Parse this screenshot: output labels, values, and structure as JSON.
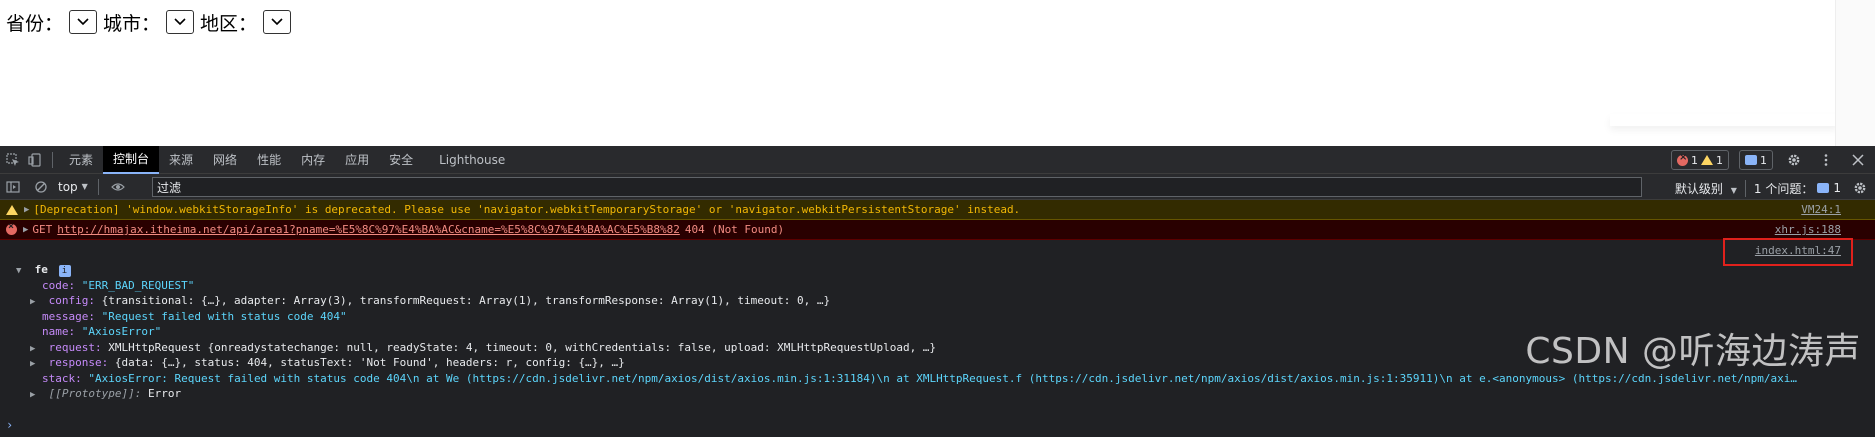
{
  "page_form": {
    "province_label": "省份：",
    "city_label": "城市：",
    "area_label": "地区："
  },
  "devtools": {
    "tabs": [
      "元素",
      "控制台",
      "来源",
      "网络",
      "性能",
      "内存",
      "应用",
      "安全",
      "Lighthouse"
    ],
    "active_tab": "控制台",
    "error_count": "1",
    "warning_count": "1",
    "message_count": "1",
    "context": "top",
    "filter_placeholder": "过滤",
    "level": "默认级别",
    "issues_label": "1 个问题：",
    "issues_count": "1"
  },
  "console": {
    "warning_text": "[Deprecation] 'window.webkitStorageInfo' is deprecated. Please use 'navigator.webkitTemporaryStorage' or 'navigator.webkitPersistentStorage' instead.",
    "warning_source": "VM24:1",
    "error_method": "GET",
    "error_url": "http://hmajax.itheima.net/api/area1?pname=%E5%8C%97%E4%BA%AC&cname=%E5%8C%97%E4%BA%AC%E5%B8%82",
    "error_status": "404 (Not Found)",
    "error_source": "xhr.js:188",
    "object_source": "index.html:47",
    "object_name": "fe",
    "object_info_badge": "i",
    "lines": {
      "code_key": "code:",
      "code_val": "\"ERR_BAD_REQUEST\"",
      "config_key": "config:",
      "config_val": "{transitional: {…}, adapter: Array(3), transformRequest: Array(1), transformResponse: Array(1), timeout: 0, …}",
      "message_key": "message:",
      "message_val": "\"Request failed with status code 404\"",
      "name_key": "name:",
      "name_val": "\"AxiosError\"",
      "request_key": "request:",
      "request_val": "XMLHttpRequest {onreadystatechange: null, readyState: 4, timeout: 0, withCredentials: false, upload: XMLHttpRequestUpload, …}",
      "response_key": "response:",
      "response_val": "{data: {…}, status: 404, statusText: 'Not Found', headers: r, config: {…}, …}",
      "stack_key": "stack:",
      "stack_val": "\"AxiosError: Request failed with status code 404\\n    at We (https://cdn.jsdelivr.net/npm/axios/dist/axios.min.js:1:31184)\\n    at XMLHttpRequest.f (https://cdn.jsdelivr.net/npm/axios/dist/axios.min.js:1:35911)\\n    at e.<anonymous> (https://cdn.jsdelivr.net/npm/axi…",
      "prototype_key": "[[Prototype]]:",
      "prototype_val": "Error"
    },
    "prompt_symbol": "›"
  },
  "watermark": "CSDN @听海边涛声",
  "colors": {
    "devtools_bg": "#202124",
    "warning_bg": "#332b00",
    "error_bg": "#290000",
    "highlight_box": "#e0211c",
    "accent": "#8ab4f8"
  }
}
